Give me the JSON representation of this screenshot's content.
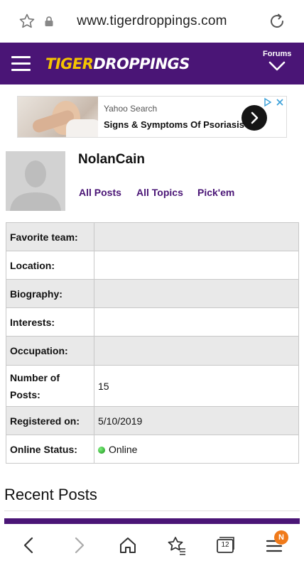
{
  "browser": {
    "url": "www.tigerdroppings.com",
    "tab_count": "12",
    "notification_badge": "N",
    "icons": [
      "star-icon",
      "lock-icon",
      "reload-icon",
      "back-icon",
      "forward-icon",
      "home-icon",
      "bookmarks-icon",
      "tabs-icon",
      "menu-icon"
    ]
  },
  "header": {
    "logo_tiger": "TIGER",
    "logo_droppings": "DROPPINGS",
    "forums_label": "Forums",
    "bg_color": "#4a1576",
    "logo_color": "#f5c400"
  },
  "ad": {
    "source": "Yahoo Search",
    "title": "Signs & Symptoms Of Psoriasis"
  },
  "profile": {
    "username": "NolanCain",
    "links": [
      {
        "label": "All Posts"
      },
      {
        "label": "All Topics"
      },
      {
        "label": "Pick'em"
      }
    ]
  },
  "info_rows": [
    {
      "label": "Favorite team:",
      "value": ""
    },
    {
      "label": "Location:",
      "value": ""
    },
    {
      "label": "Biography:",
      "value": ""
    },
    {
      "label": "Interests:",
      "value": ""
    },
    {
      "label": "Occupation:",
      "value": ""
    },
    {
      "label_line1": "Number of",
      "label_line2": "Posts:",
      "value": "15"
    },
    {
      "label": "Registered on:",
      "value": "5/10/2019"
    },
    {
      "label": "Online Status:",
      "value": "Online",
      "status_color": "#1a8f1a"
    }
  ],
  "recent_posts": {
    "heading": "Recent Posts"
  }
}
